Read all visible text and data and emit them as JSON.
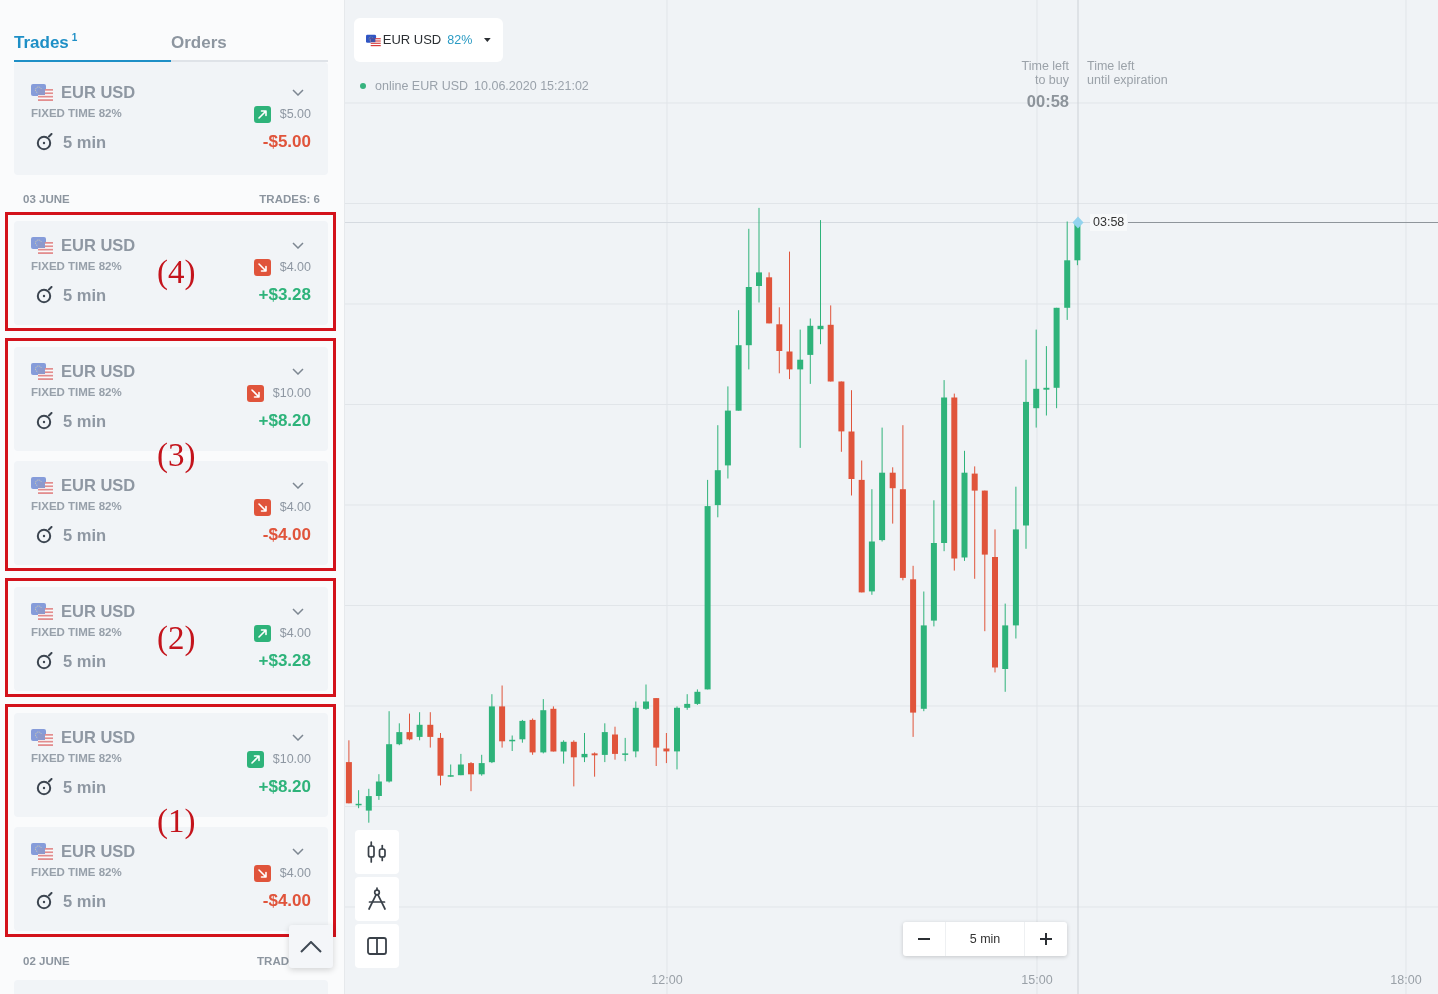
{
  "trades_panel": {
    "tabs": [
      {
        "label": "Trades",
        "badge": "1",
        "selected": true
      },
      {
        "label": "Orders",
        "selected": false
      }
    ],
    "open_trades": [
      {
        "pair": "EUR USD",
        "mode": "FIXED TIME 82%",
        "up": true,
        "amount": "$5.00",
        "duration": "5 min",
        "result": "-$5.00",
        "profit": false,
        "expanded": false
      }
    ],
    "days": [
      {
        "date": "03 JUNE",
        "count": "TRADES: 6",
        "groups": [
          {
            "annotation": "(4)",
            "trades": [
              {
                "pair": "EUR USD",
                "mode": "FIXED TIME 82%",
                "up": false,
                "amount": "$4.00",
                "duration": "5 min",
                "result": "+$3.28",
                "profit": true,
                "expanded": false
              }
            ]
          },
          {
            "annotation": "(3)",
            "trades": [
              {
                "pair": "EUR USD",
                "mode": "FIXED TIME 82%",
                "up": false,
                "amount": "$10.00",
                "duration": "5 min",
                "result": "+$8.20",
                "profit": true,
                "expanded": false
              },
              {
                "pair": "EUR USD",
                "mode": "FIXED TIME 82%",
                "up": false,
                "amount": "$4.00",
                "duration": "5 min",
                "result": "-$4.00",
                "profit": false,
                "expanded": false
              }
            ]
          },
          {
            "annotation": "(2)",
            "trades": [
              {
                "pair": "EUR USD",
                "mode": "FIXED TIME 82%",
                "up": true,
                "amount": "$4.00",
                "duration": "5 min",
                "result": "+$3.28",
                "profit": true,
                "expanded": false
              }
            ]
          },
          {
            "annotation": "(1)",
            "trades": [
              {
                "pair": "EUR USD",
                "mode": "FIXED TIME 82%",
                "up": true,
                "amount": "$10.00",
                "duration": "5 min",
                "result": "+$8.20",
                "profit": true,
                "expanded": false
              },
              {
                "pair": "EUR USD",
                "mode": "FIXED TIME 82%",
                "up": false,
                "amount": "$4.00",
                "duration": "5 min",
                "result": "-$4.00",
                "profit": false,
                "expanded": false
              }
            ]
          }
        ]
      },
      {
        "date": "02 JUNE",
        "count": "TRAD"
      }
    ]
  },
  "chart": {
    "symbol_selector": {
      "pair": "EUR USD",
      "payout": "82%"
    },
    "feed_status": {
      "online": true,
      "text": "online EUR USD",
      "timestamp": "10.06.2020 15:21:02"
    },
    "time_left_to_buy": {
      "label": "Time left\nto buy",
      "value": "00:58"
    },
    "time_left_until_expiration": {
      "label": "Time left\nuntil expiration"
    },
    "current_price_time": "03:58",
    "time_axis_labels": [
      "12:00",
      "15:00",
      "18:00"
    ],
    "timeframe": "5 min"
  }
}
